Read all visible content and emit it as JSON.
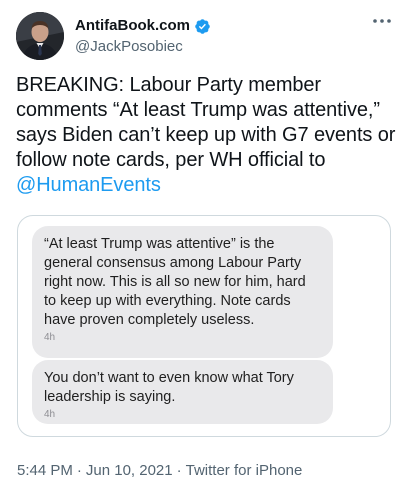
{
  "author": {
    "display_name": "AntifaBook.com",
    "handle": "@JackPosobiec",
    "verified": true
  },
  "tweet": {
    "text_before": "BREAKING: Labour Party member comments “At least Trump was attentive,” says Biden can’t keep up with G7 events or follow note cards, per WH official to ",
    "mention": "@HumanEvents"
  },
  "media": {
    "messages": [
      {
        "text": "“At least Trump was attentive” is the general consensus among Labour Party right now. This is all so new for him, hard to keep up with everything. Note cards have proven completely useless.",
        "time": "4h"
      },
      {
        "text": "You don’t want to even know what Tory leadership is saying.",
        "time": "4h"
      }
    ]
  },
  "meta": {
    "time": "5:44 PM",
    "date": "Jun 10, 2021",
    "separator": "·",
    "source": "Twitter for iPhone"
  },
  "colors": {
    "accent": "#1d9bf0",
    "text": "#0f1419",
    "secondary": "#536471",
    "bubble": "#e9e9eb"
  }
}
